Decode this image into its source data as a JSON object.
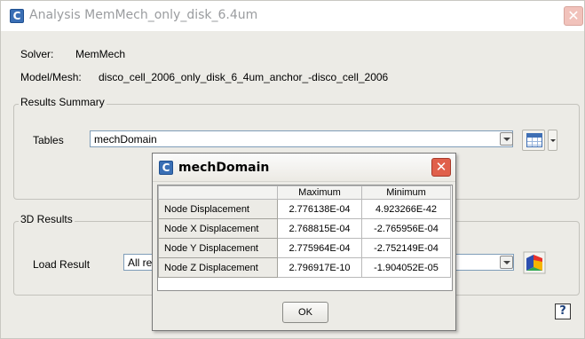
{
  "window": {
    "title": "Analysis MemMech_only_disk_6.4um",
    "app_icon_glyph": "C",
    "close_glyph": "✕"
  },
  "info": {
    "solver_label": "Solver:",
    "solver_value": "MemMech",
    "model_label": "Model/Mesh:",
    "model_value": "disco_cell_2006_only_disk_6_4um_anchor_-disco_cell_2006"
  },
  "results_summary": {
    "group_title": "Results Summary",
    "tables_label": "Tables",
    "tables_value": "mechDomain"
  },
  "results_3d": {
    "group_title": "3D Results",
    "load_label": "Load Result",
    "load_value_partial": "All re"
  },
  "popup": {
    "title": "mechDomain",
    "app_icon_glyph": "C",
    "close_glyph": "✕",
    "columns": [
      "",
      "Maximum",
      "Minimum"
    ],
    "rows": [
      {
        "label": "Node  Displacement",
        "max": "2.776138E-04",
        "min": "4.923266E-42"
      },
      {
        "label": "Node X Displacement",
        "max": "2.768815E-04",
        "min": "-2.765956E-04"
      },
      {
        "label": "Node Y Displacement",
        "max": "2.775964E-04",
        "min": "-2.752149E-04"
      },
      {
        "label": "Node Z Displacement",
        "max": "2.796917E-10",
        "min": "-1.904052E-05"
      }
    ],
    "ok_label": "OK"
  },
  "icons": {
    "help_glyph": "?"
  },
  "colors": {
    "close_button_active": "#e0604b",
    "close_button_inactive": "#f1c2bb",
    "window_bg": "#ecebe6",
    "accent_blue": "#3a6fb5"
  }
}
